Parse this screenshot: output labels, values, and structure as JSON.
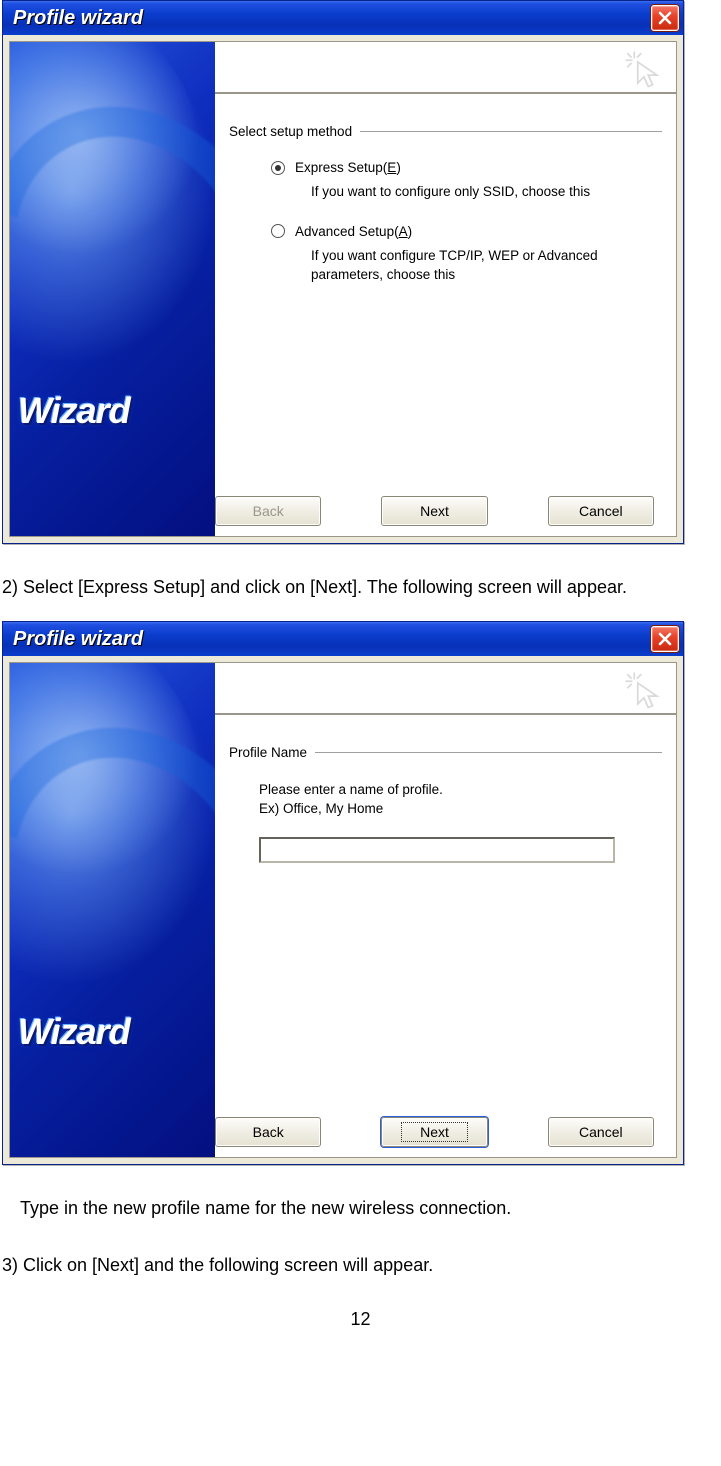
{
  "page_number": "12",
  "step2_text": "2) Select [Express Setup] and click on [Next]. The following screen will appear.",
  "type_in_text": "Type in the new profile name for the new wireless connection.",
  "step3_text": "3) Click on [Next] and the following screen will appear.",
  "dialog1": {
    "title": "Profile wizard",
    "side_label": "Wizard",
    "section_label": "Select setup method",
    "option_express_prefix": "Express Setup(",
    "option_express_hotkey": "E",
    "option_express_suffix": ")",
    "option_express_desc": "If you want to configure only SSID, choose this",
    "option_advanced_prefix": "Advanced Setup(",
    "option_advanced_hotkey": "A",
    "option_advanced_suffix": ")",
    "option_advanced_desc": "If you want configure TCP/IP, WEP or Advanced parameters, choose this",
    "back": "Back",
    "next": "Next",
    "cancel": "Cancel"
  },
  "dialog2": {
    "title": "Profile wizard",
    "side_label": "Wizard",
    "section_label": "Profile Name",
    "desc": "Please enter a name of profile.\nEx) Office, My Home",
    "input_value": "",
    "back": "Back",
    "next": "Next",
    "cancel": "Cancel"
  }
}
